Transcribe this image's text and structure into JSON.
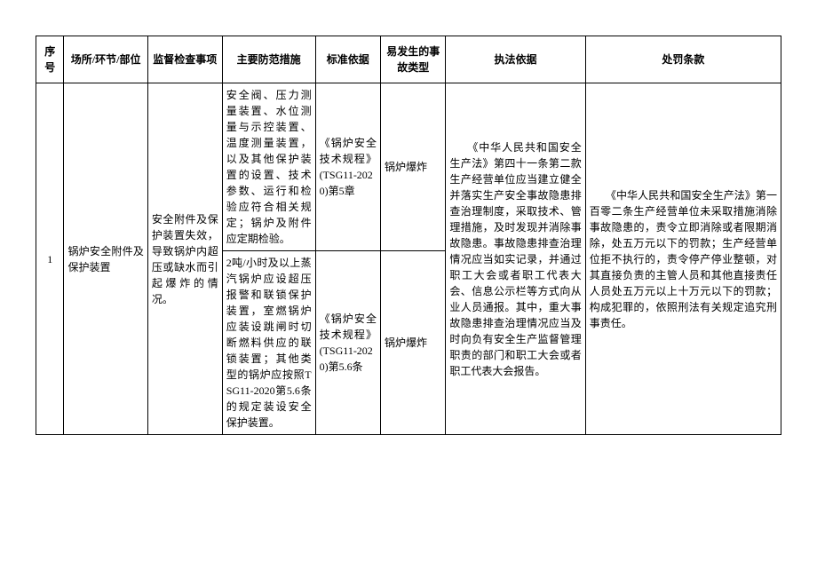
{
  "headers": {
    "seq": "序号",
    "place": "场所/环节/部位",
    "check": "监督检查事项",
    "measure": "主要防范措施",
    "basis": "标准依据",
    "accident": "易发生的事故类型",
    "law": "执法依据",
    "penalty": "处罚条款"
  },
  "row": {
    "seq": "1",
    "place": "锅炉安全附件及保护装置",
    "check": "安全附件及保护装置失效，导致锅炉内超压或缺水而引起爆炸的情况。",
    "measure1": "安全阀、压力测量装置、水位测量与示控装置、温度测量装置，以及其他保护装置的设置、技术参数、运行和检验应符合相关规定；锅炉及附件应定期检验。",
    "basis1": "《锅炉安全技术规程》(TSG11-2020)第5章",
    "accident1": "锅炉爆炸",
    "measure2": "2吨/小时及以上蒸汽锅炉应设超压报警和联锁保护装置，室燃锅炉应装设跳闸时切断燃料供应的联锁装置；其他类型的锅炉应按照TSG11-2020第5.6条的规定装设安全保护装置。",
    "basis2": "《锅炉安全技术规程》(TSG11-2020)第5.6条",
    "accident2": "锅炉爆炸",
    "law": "　　《中华人民共和国安全生产法》第四十一条第二款生产经营单位应当建立健全并落实生产安全事故隐患排查治理制度，采取技术、管理措施，及时发现并消除事故隐患。事故隐患排查治理情况应当如实记录，并通过职工大会或者职工代表大会、信息公示栏等方式向从业人员通报。其中，重大事故隐患排查治理情况应当及时向负有安全生产监督管理职责的部门和职工大会或者职工代表大会报告。",
    "penalty": "　　《中华人民共和国安全生产法》第一百零二条生产经营单位未采取措施消除事故隐患的，责令立即消除或者限期消除，处五万元以下的罚款；生产经营单位拒不执行的，责令停产停业整顿，对其直接负责的主管人员和其他直接责任人员处五万元以上十万元以下的罚款；构成犯罪的，依照刑法有关规定追究刑事责任。"
  }
}
